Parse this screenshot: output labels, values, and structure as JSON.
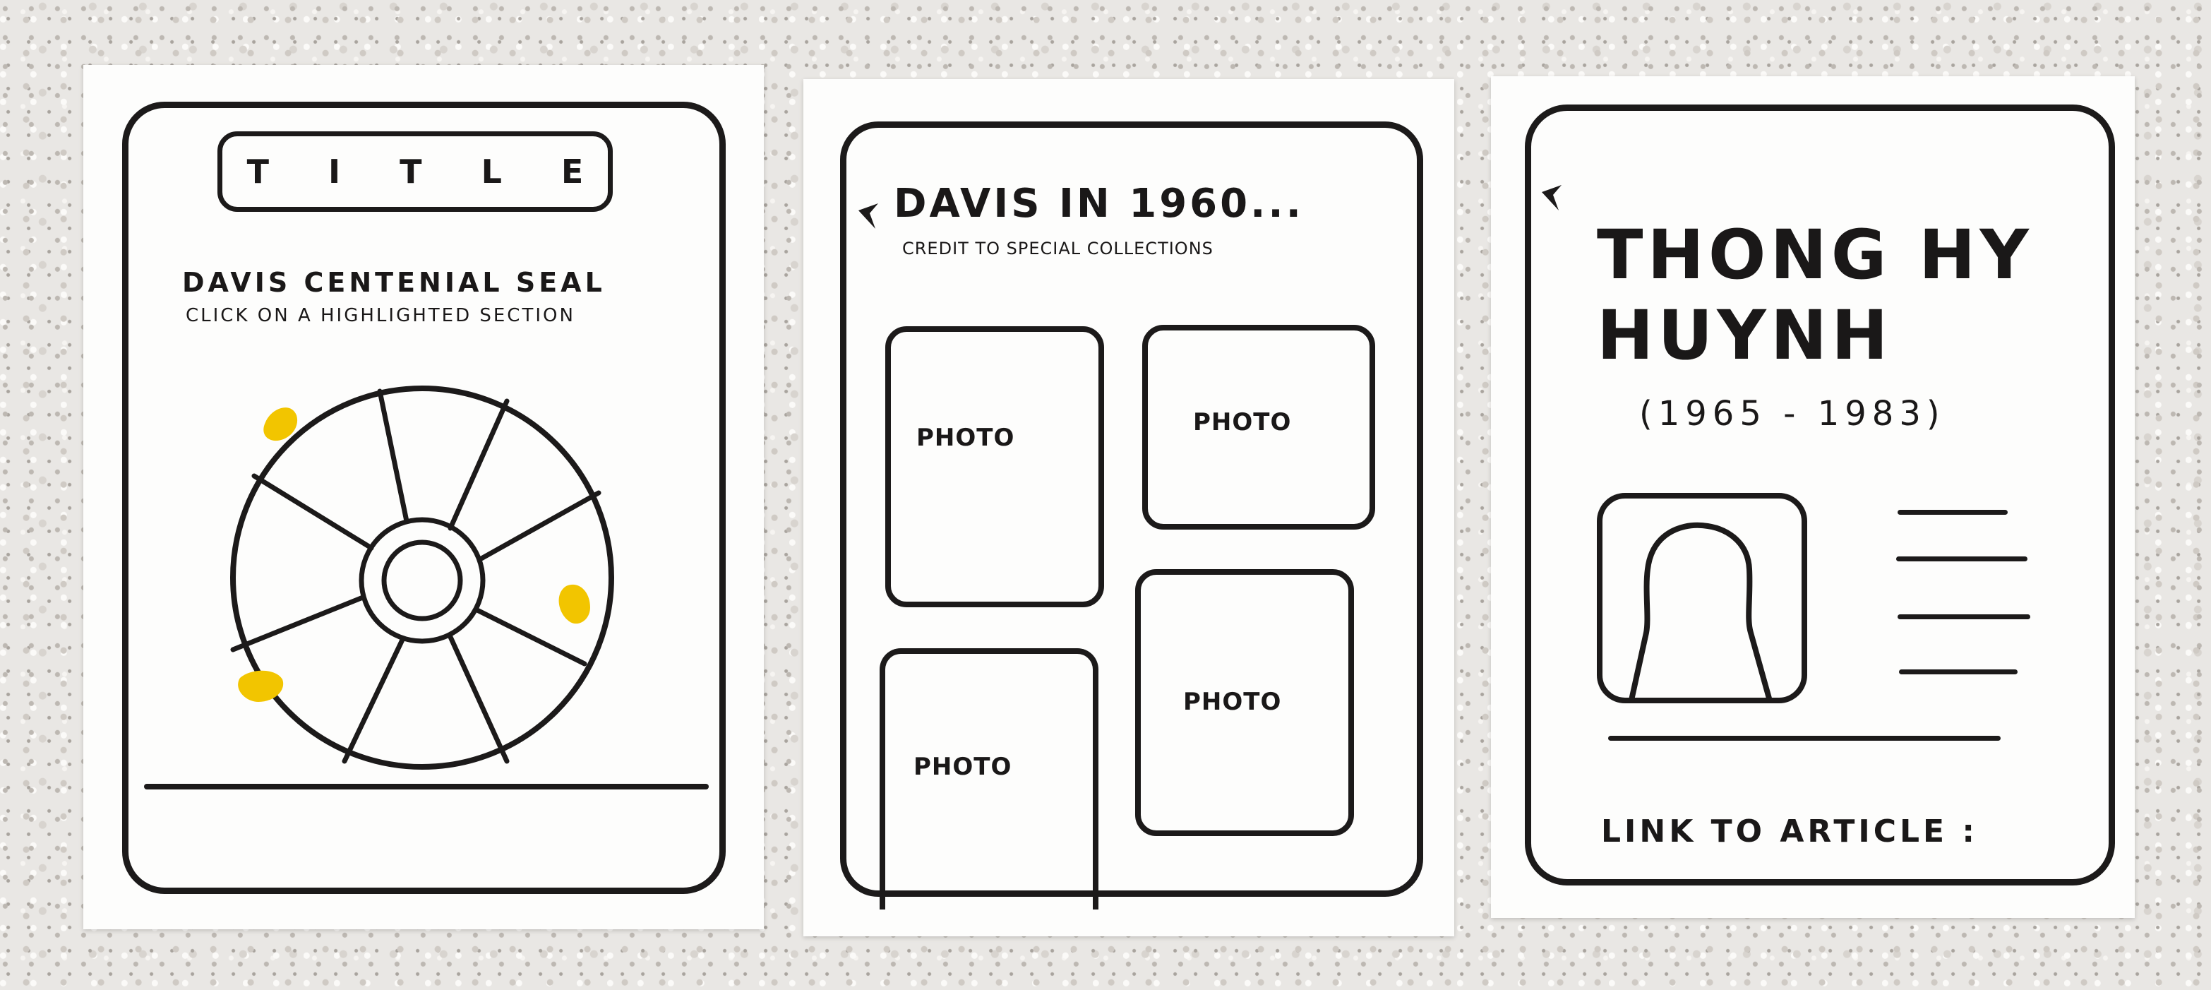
{
  "colors": {
    "ink": "#1c1a1a",
    "highlight": "#f2c500",
    "paper": "#fdfdfc",
    "background": "#e9e7e4"
  },
  "screen_seal": {
    "title": "T I T L E",
    "heading": "DAVIS CENTENIAL SEAL",
    "subheading": "CLICK ON A HIGHLIGHTED SECTION",
    "highlighted_sections": 3
  },
  "screen_gallery": {
    "back_icon": "back-arrow-icon",
    "title": "DAVIS IN 1960...",
    "credit": "CREDIT TO SPECIAL COLLECTIONS",
    "photos": [
      "PHOTO",
      "PHOTO",
      "PHOTO",
      "PHOTO"
    ]
  },
  "screen_profile": {
    "back_icon": "back-arrow-icon",
    "name": "THONG HY\nHUYNH",
    "dates": "(1965 - 1983)",
    "portrait_icon": "person-silhouette-icon",
    "article_link_label": "LINK TO ARTICLE :"
  }
}
